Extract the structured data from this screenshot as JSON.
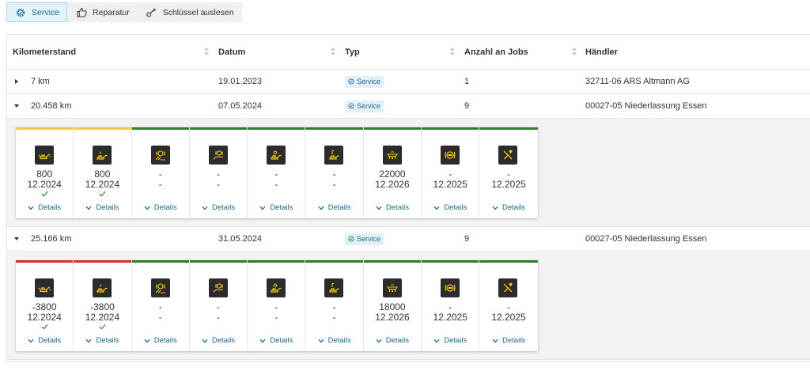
{
  "toolbar": {
    "buttons": [
      {
        "label": "Service",
        "icon": "service-gear-icon",
        "active": true
      },
      {
        "label": "Reparatur",
        "icon": "thumbs-up-icon",
        "active": false
      },
      {
        "label": "Schlüssel auslesen",
        "icon": "key-icon",
        "active": false
      }
    ]
  },
  "table": {
    "columns": [
      "Kilometerstand",
      "Datum",
      "Typ",
      "Anzahl an Jobs",
      "Händler"
    ],
    "rows": [
      {
        "km": "7 km",
        "date": "19.01.2023",
        "type": "Service",
        "jobs": "1",
        "dealer": "32711-06 ARS Altmann AG",
        "expanded": false
      },
      {
        "km": "20.458 km",
        "date": "07.05.2024",
        "type": "Service",
        "jobs": "9",
        "dealer": "00027-05 Niederlassung Essen",
        "expanded": true
      },
      {
        "km": "25.166 km",
        "date": "31.05.2024",
        "type": "Service",
        "jobs": "9",
        "dealer": "00027-05 Niederlassung Essen",
        "expanded": true
      }
    ]
  },
  "details_label": "Details",
  "colors": {
    "yellow": "#f2c94c",
    "green": "#2e7d32",
    "red": "#d32f2f",
    "icon_yellow": "#f5c518",
    "accent": "#1d6a8c"
  },
  "panels": [
    {
      "cards": [
        {
          "icon": "oil-can-icon",
          "v1": "800",
          "v2": "12.2024",
          "check": true,
          "status": "yellow"
        },
        {
          "icon": "engine-oil-level-icon",
          "v1": "800",
          "v2": "12.2024",
          "check": true,
          "status": "yellow"
        },
        {
          "icon": "front-brake-icon",
          "v1": "-",
          "v2": "-",
          "check": false,
          "status": "green"
        },
        {
          "icon": "rear-brake-icon",
          "v1": "-",
          "v2": "-",
          "check": false,
          "status": "green"
        },
        {
          "icon": "brake-fluid-icon",
          "v1": "-",
          "v2": "-",
          "check": false,
          "status": "green"
        },
        {
          "icon": "coolant-icon",
          "v1": "-",
          "v2": "-",
          "check": false,
          "status": "green"
        },
        {
          "icon": "vehicle-check-icon",
          "v1": "22000",
          "v2": "12.2026",
          "check": false,
          "status": "green"
        },
        {
          "icon": "brake-disc-icon",
          "v1": "-",
          "v2": "12.2025",
          "check": false,
          "status": "green"
        },
        {
          "icon": "tools-icon",
          "v1": "-",
          "v2": "12.2025",
          "check": false,
          "status": "green"
        }
      ]
    },
    {
      "cards": [
        {
          "icon": "oil-can-icon",
          "v1": "-3800",
          "v2": "12.2024",
          "check": true,
          "status": "red"
        },
        {
          "icon": "engine-oil-level-icon",
          "v1": "-3800",
          "v2": "12.2024",
          "check": true,
          "status": "red"
        },
        {
          "icon": "front-brake-icon",
          "v1": "-",
          "v2": "-",
          "check": false,
          "status": "green"
        },
        {
          "icon": "rear-brake-icon",
          "v1": "-",
          "v2": "-",
          "check": false,
          "status": "green"
        },
        {
          "icon": "brake-fluid-icon",
          "v1": "-",
          "v2": "-",
          "check": false,
          "status": "green"
        },
        {
          "icon": "coolant-icon",
          "v1": "-",
          "v2": "-",
          "check": false,
          "status": "green"
        },
        {
          "icon": "vehicle-check-icon",
          "v1": "18000",
          "v2": "12.2026",
          "check": false,
          "status": "green"
        },
        {
          "icon": "brake-disc-icon",
          "v1": "-",
          "v2": "12.2025",
          "check": false,
          "status": "green"
        },
        {
          "icon": "tools-icon",
          "v1": "-",
          "v2": "12.2025",
          "check": false,
          "status": "green"
        }
      ]
    }
  ]
}
